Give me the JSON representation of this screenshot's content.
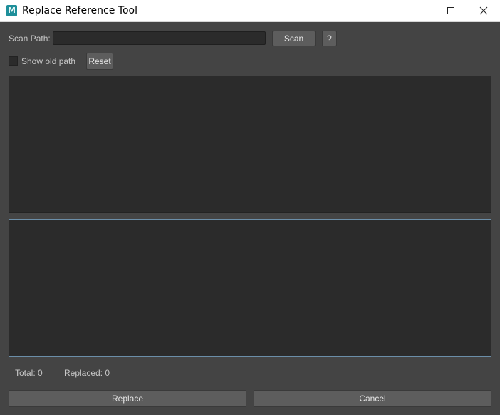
{
  "window": {
    "title": "Replace Reference Tool",
    "icon": "maya-app-icon",
    "icon_letter": "M",
    "controls": [
      "minimize-icon",
      "maximize-icon",
      "close-icon"
    ]
  },
  "scan": {
    "label": "Scan Path:",
    "value": "",
    "button_label": "Scan",
    "help_label": "?"
  },
  "options": {
    "show_old_path_label": "Show old path",
    "show_old_path_checked": false,
    "reset_label": "Reset"
  },
  "status": {
    "total": "Total: 0",
    "replaced": "Replaced: 0"
  },
  "actions": {
    "replace_label": "Replace",
    "cancel_label": "Cancel"
  },
  "colors": {
    "background": "#444444",
    "field": "#2b2b2b",
    "button": "#5d5d5d",
    "focus_border": "#6b8ea8"
  }
}
